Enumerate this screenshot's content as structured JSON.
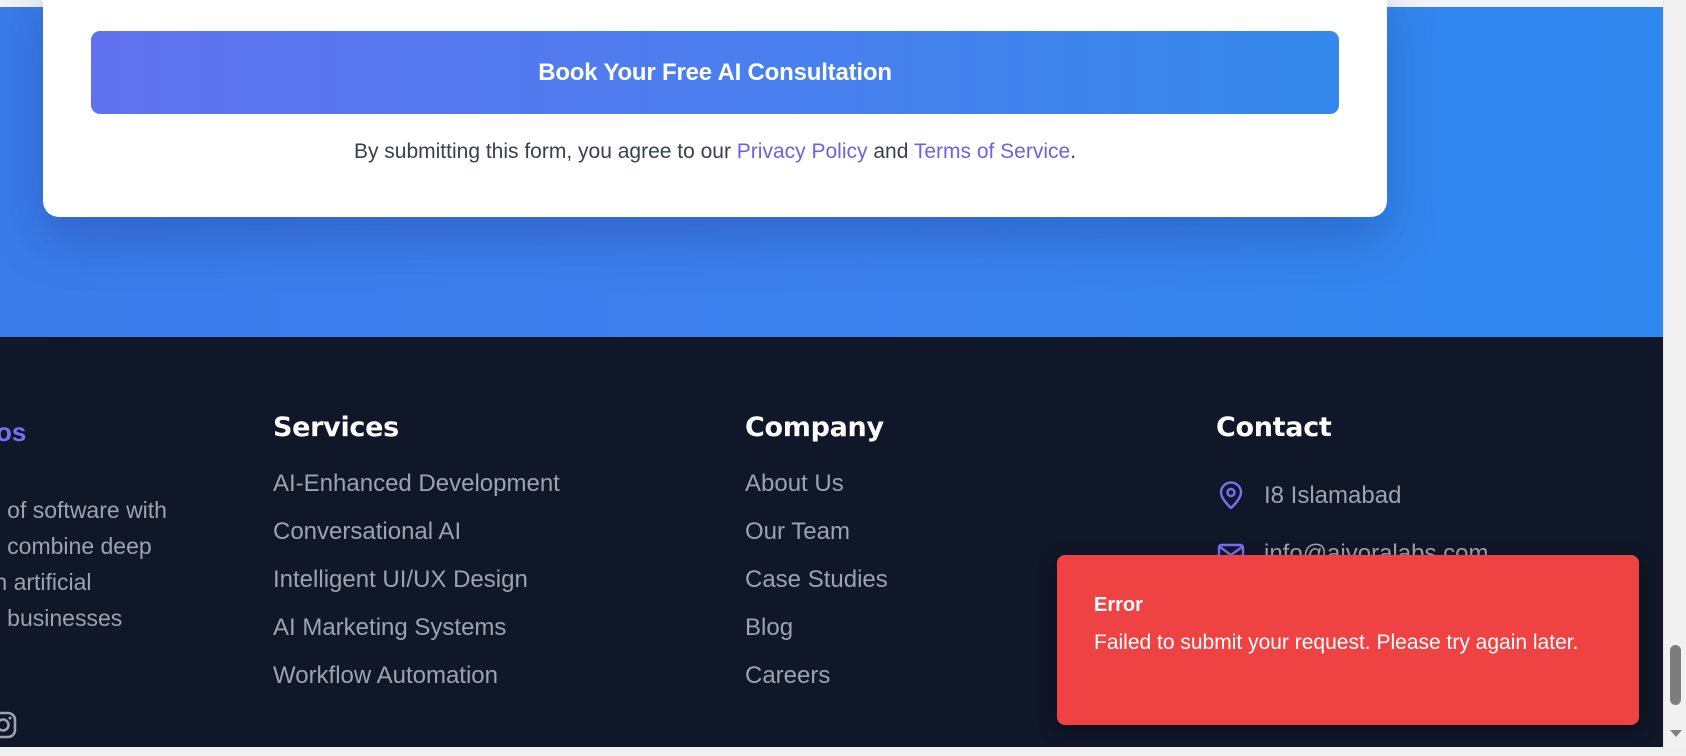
{
  "form": {
    "submit_label": "Book Your Free AI Consultation",
    "disclaimer_prefix": "By submitting this form, you agree to our ",
    "privacy_link": "Privacy Policy",
    "disclaimer_and": " and ",
    "terms_link": "Terms of Service",
    "disclaimer_suffix": "."
  },
  "footer": {
    "brand": {
      "title": "os",
      "description": "e of software with\ne combine deep\nth artificial\np businesses",
      "social_icon": "instagram-icon"
    },
    "services": {
      "heading": "Services",
      "items": [
        "AI-Enhanced Development",
        "Conversational AI",
        "Intelligent UI/UX Design",
        "AI Marketing Systems",
        "Workflow Automation"
      ]
    },
    "company": {
      "heading": "Company",
      "items": [
        "About Us",
        "Our Team",
        "Case Studies",
        "Blog",
        "Careers"
      ]
    },
    "contact": {
      "heading": "Contact",
      "address": "I8 Islamabad",
      "address_icon": "map-pin-icon",
      "email": "info@aivoralabs.com",
      "email_icon": "mail-icon"
    }
  },
  "toast": {
    "title": "Error",
    "message": "Failed to submit your request. Please try again later."
  },
  "colors": {
    "accent": "#6b63e6",
    "hero_blue": "#3a7bea",
    "footer_bg": "#0f1729",
    "error": "#ef4343"
  }
}
